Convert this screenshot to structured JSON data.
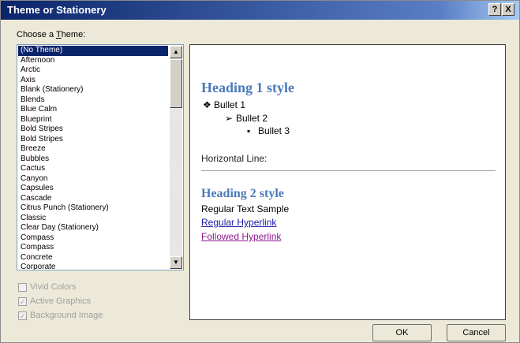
{
  "window": {
    "title": "Theme or Stationery",
    "help_label": "?",
    "close_label": "X"
  },
  "theme_list": {
    "label_prefix": "Choose a ",
    "label_underlined": "T",
    "label_suffix": "heme:",
    "items": [
      "(No Theme)",
      "Afternoon",
      "Arctic",
      "Axis",
      "Blank (Stationery)",
      "Blends",
      "Blue Calm",
      "Blueprint",
      "Bold Stripes",
      "Bold Stripes",
      "Breeze",
      "Bubbles",
      "Cactus",
      "Canyon",
      "Capsules",
      "Cascade",
      "Citrus Punch (Stationery)",
      "Classic",
      "Clear Day (Stationery)",
      "Compass",
      "Compass",
      "Concrete",
      "Corporate"
    ],
    "selected_index": 0,
    "scroll_up_glyph": "▲",
    "scroll_down_glyph": "▼"
  },
  "options": [
    {
      "label": "Vivid Colors",
      "checked": false
    },
    {
      "label": "Active Graphics",
      "checked": true
    },
    {
      "label": "Background Image",
      "checked": true
    }
  ],
  "preview": {
    "heading1": "Heading 1 style",
    "bullet1": "Bullet 1",
    "bullet2": "Bullet 2",
    "bullet3": "Bullet 3",
    "bullet1_glyph": "❖",
    "bullet2_glyph": "➢",
    "bullet3_glyph": "▪",
    "hr_label": "Horizontal Line:",
    "heading2": "Heading 2 style",
    "regular_text": "Regular Text Sample",
    "hyperlink": "Regular Hyperlink",
    "followed_hyperlink": "Followed Hyperlink"
  },
  "buttons": {
    "ok": "OK",
    "cancel": "Cancel"
  },
  "colors": {
    "heading": "#4a7ab8",
    "link": "#1a1aa8",
    "followed_link": "#8e1a8e",
    "selection": "#0a246a"
  }
}
